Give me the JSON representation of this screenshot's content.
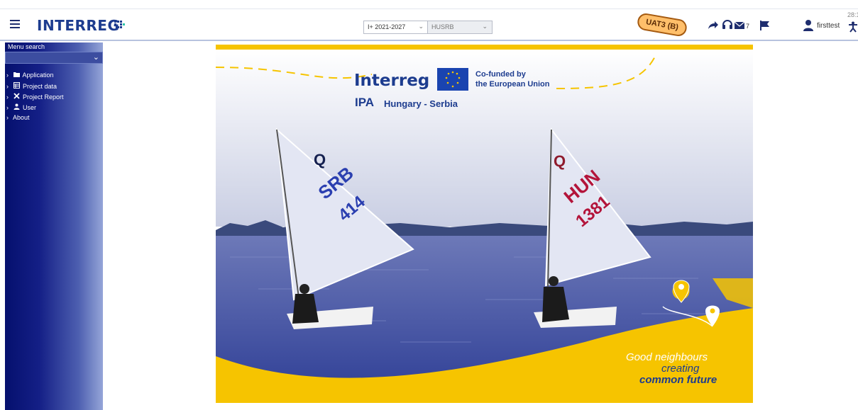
{
  "header": {
    "logo": "INTERREG",
    "program_period": {
      "value": "I+ 2021-2027"
    },
    "program_code": {
      "value": "HUSRB"
    },
    "environment_badge": "UAT3 (B)",
    "messages_count": "7",
    "username": "firsttest",
    "clock": "28:1"
  },
  "sidebar": {
    "search_label": "Menu search",
    "items": [
      {
        "label": "Application",
        "icon": "folder-icon"
      },
      {
        "label": "Project data",
        "icon": "table-icon"
      },
      {
        "label": "Project Report",
        "icon": "tools-icon"
      },
      {
        "label": "User",
        "icon": "user-icon"
      },
      {
        "label": "About",
        "icon": ""
      }
    ]
  },
  "banner": {
    "brand": "Interreg",
    "cofunded_line1": "Co-funded by",
    "cofunded_line2": "the European Union",
    "programme_prefix": "IPA",
    "programme_name": "Hungary - Serbia",
    "sail_left_code": "SRB",
    "sail_left_number": "414",
    "sail_right_code": "HUN",
    "sail_right_number": "1381",
    "slogan_line1": "Good neighbours",
    "slogan_line2": "creating",
    "slogan_line3": "common future"
  },
  "colors": {
    "brand_blue": "#1d3c8f",
    "sidebar_dark": "#05106e",
    "banner_yellow": "#f6c400",
    "water": "#3d4fa5"
  }
}
